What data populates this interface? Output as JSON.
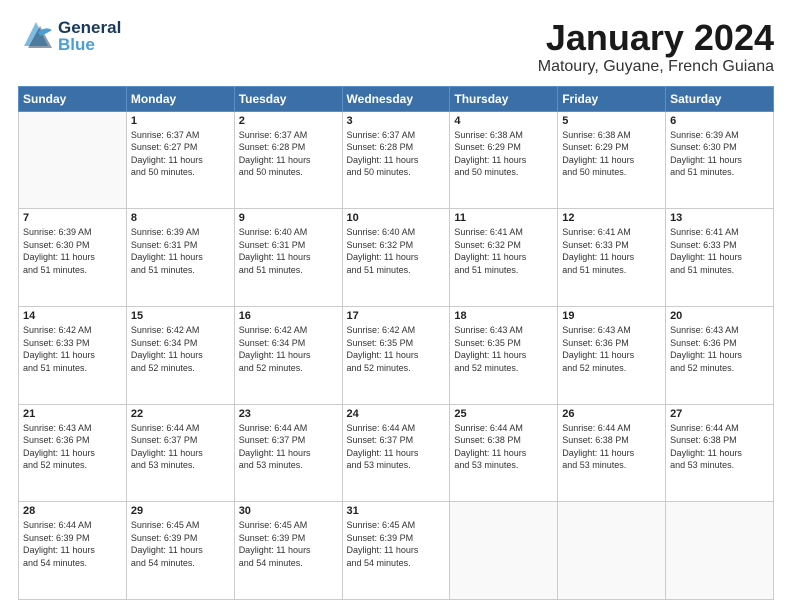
{
  "header": {
    "logo_general": "General",
    "logo_blue": "Blue",
    "title": "January 2024",
    "subtitle": "Matoury, Guyane, French Guiana"
  },
  "days_of_week": [
    "Sunday",
    "Monday",
    "Tuesday",
    "Wednesday",
    "Thursday",
    "Friday",
    "Saturday"
  ],
  "weeks": [
    [
      {
        "date": "",
        "info": ""
      },
      {
        "date": "1",
        "info": "Sunrise: 6:37 AM\nSunset: 6:27 PM\nDaylight: 11 hours\nand 50 minutes."
      },
      {
        "date": "2",
        "info": "Sunrise: 6:37 AM\nSunset: 6:28 PM\nDaylight: 11 hours\nand 50 minutes."
      },
      {
        "date": "3",
        "info": "Sunrise: 6:37 AM\nSunset: 6:28 PM\nDaylight: 11 hours\nand 50 minutes."
      },
      {
        "date": "4",
        "info": "Sunrise: 6:38 AM\nSunset: 6:29 PM\nDaylight: 11 hours\nand 50 minutes."
      },
      {
        "date": "5",
        "info": "Sunrise: 6:38 AM\nSunset: 6:29 PM\nDaylight: 11 hours\nand 50 minutes."
      },
      {
        "date": "6",
        "info": "Sunrise: 6:39 AM\nSunset: 6:30 PM\nDaylight: 11 hours\nand 51 minutes."
      }
    ],
    [
      {
        "date": "7",
        "info": "Sunrise: 6:39 AM\nSunset: 6:30 PM\nDaylight: 11 hours\nand 51 minutes."
      },
      {
        "date": "8",
        "info": "Sunrise: 6:39 AM\nSunset: 6:31 PM\nDaylight: 11 hours\nand 51 minutes."
      },
      {
        "date": "9",
        "info": "Sunrise: 6:40 AM\nSunset: 6:31 PM\nDaylight: 11 hours\nand 51 minutes."
      },
      {
        "date": "10",
        "info": "Sunrise: 6:40 AM\nSunset: 6:32 PM\nDaylight: 11 hours\nand 51 minutes."
      },
      {
        "date": "11",
        "info": "Sunrise: 6:41 AM\nSunset: 6:32 PM\nDaylight: 11 hours\nand 51 minutes."
      },
      {
        "date": "12",
        "info": "Sunrise: 6:41 AM\nSunset: 6:33 PM\nDaylight: 11 hours\nand 51 minutes."
      },
      {
        "date": "13",
        "info": "Sunrise: 6:41 AM\nSunset: 6:33 PM\nDaylight: 11 hours\nand 51 minutes."
      }
    ],
    [
      {
        "date": "14",
        "info": "Sunrise: 6:42 AM\nSunset: 6:33 PM\nDaylight: 11 hours\nand 51 minutes."
      },
      {
        "date": "15",
        "info": "Sunrise: 6:42 AM\nSunset: 6:34 PM\nDaylight: 11 hours\nand 52 minutes."
      },
      {
        "date": "16",
        "info": "Sunrise: 6:42 AM\nSunset: 6:34 PM\nDaylight: 11 hours\nand 52 minutes."
      },
      {
        "date": "17",
        "info": "Sunrise: 6:42 AM\nSunset: 6:35 PM\nDaylight: 11 hours\nand 52 minutes."
      },
      {
        "date": "18",
        "info": "Sunrise: 6:43 AM\nSunset: 6:35 PM\nDaylight: 11 hours\nand 52 minutes."
      },
      {
        "date": "19",
        "info": "Sunrise: 6:43 AM\nSunset: 6:36 PM\nDaylight: 11 hours\nand 52 minutes."
      },
      {
        "date": "20",
        "info": "Sunrise: 6:43 AM\nSunset: 6:36 PM\nDaylight: 11 hours\nand 52 minutes."
      }
    ],
    [
      {
        "date": "21",
        "info": "Sunrise: 6:43 AM\nSunset: 6:36 PM\nDaylight: 11 hours\nand 52 minutes."
      },
      {
        "date": "22",
        "info": "Sunrise: 6:44 AM\nSunset: 6:37 PM\nDaylight: 11 hours\nand 53 minutes."
      },
      {
        "date": "23",
        "info": "Sunrise: 6:44 AM\nSunset: 6:37 PM\nDaylight: 11 hours\nand 53 minutes."
      },
      {
        "date": "24",
        "info": "Sunrise: 6:44 AM\nSunset: 6:37 PM\nDaylight: 11 hours\nand 53 minutes."
      },
      {
        "date": "25",
        "info": "Sunrise: 6:44 AM\nSunset: 6:38 PM\nDaylight: 11 hours\nand 53 minutes."
      },
      {
        "date": "26",
        "info": "Sunrise: 6:44 AM\nSunset: 6:38 PM\nDaylight: 11 hours\nand 53 minutes."
      },
      {
        "date": "27",
        "info": "Sunrise: 6:44 AM\nSunset: 6:38 PM\nDaylight: 11 hours\nand 53 minutes."
      }
    ],
    [
      {
        "date": "28",
        "info": "Sunrise: 6:44 AM\nSunset: 6:39 PM\nDaylight: 11 hours\nand 54 minutes."
      },
      {
        "date": "29",
        "info": "Sunrise: 6:45 AM\nSunset: 6:39 PM\nDaylight: 11 hours\nand 54 minutes."
      },
      {
        "date": "30",
        "info": "Sunrise: 6:45 AM\nSunset: 6:39 PM\nDaylight: 11 hours\nand 54 minutes."
      },
      {
        "date": "31",
        "info": "Sunrise: 6:45 AM\nSunset: 6:39 PM\nDaylight: 11 hours\nand 54 minutes."
      },
      {
        "date": "",
        "info": ""
      },
      {
        "date": "",
        "info": ""
      },
      {
        "date": "",
        "info": ""
      }
    ]
  ]
}
